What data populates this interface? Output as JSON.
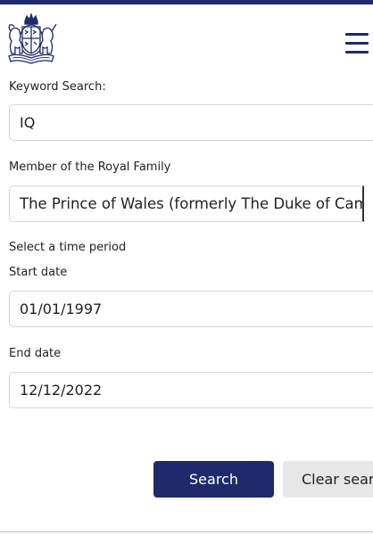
{
  "header": {
    "logo_name": "royal-coat-of-arms",
    "menu_icon": "hamburger-menu-icon"
  },
  "form": {
    "keyword_label": "Keyword Search:",
    "keyword_value": "IQ",
    "member_label": "Member of the Royal Family",
    "member_value": "The Prince of Wales (formerly The Duke of Cambridge)",
    "time_period_label": "Select a time period",
    "start_label": "Start date",
    "start_value": "01/01/1997",
    "end_label": "End date",
    "end_value": "12/12/2022"
  },
  "buttons": {
    "search_label": "Search",
    "clear_label": "Clear search"
  },
  "colors": {
    "brand": "#1f2a6b",
    "secondary_button": "#e7e7e7"
  }
}
